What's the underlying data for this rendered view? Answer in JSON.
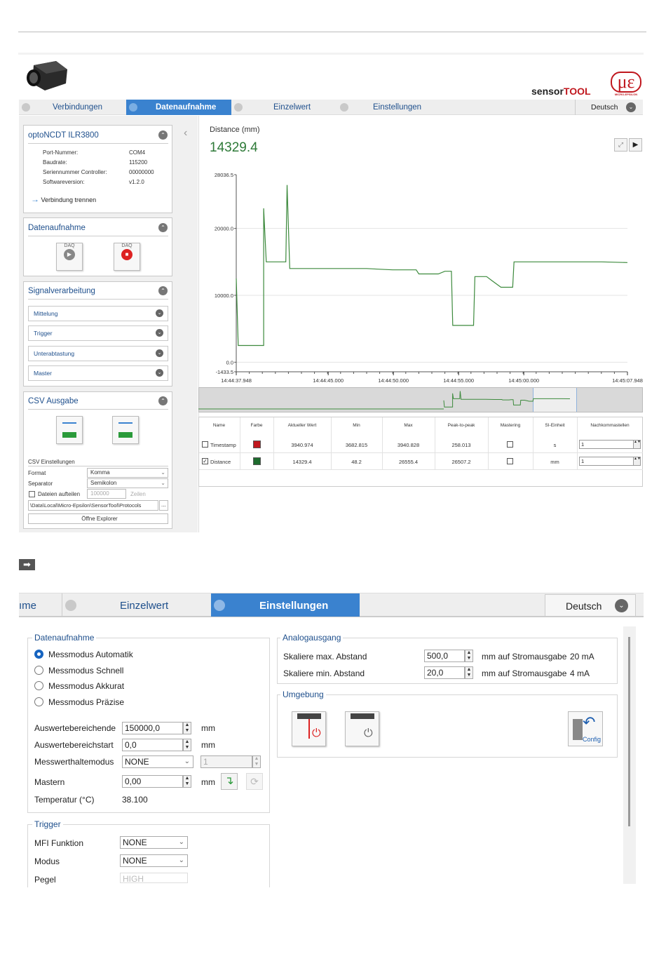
{
  "top": {
    "brand": "sensorTOOL",
    "brand_sensor": "sensor",
    "brand_tool": "TOOL",
    "logo_text": "με",
    "logo_sub": "MICRO-EPSILON",
    "language": "Deutsch"
  },
  "tabs": [
    "Verbindungen",
    "Datenaufnahme",
    "Einzelwert",
    "Einstellungen"
  ],
  "sensor_panel": {
    "title": "optoNCDT ILR3800",
    "rows": [
      {
        "k": "Port-Nummer:",
        "v": "COM4"
      },
      {
        "k": "Baudrate:",
        "v": "115200"
      },
      {
        "k": "Seriennummer Controller:",
        "v": "00000000"
      },
      {
        "k": "Softwareversion:",
        "v": "v1.2.0"
      }
    ],
    "disconnect": "Verbindung trennen"
  },
  "daq_panel": {
    "title": "Datenaufnahme",
    "btn_label": "DAQ"
  },
  "signal_panel": {
    "title": "Signalverarbeitung",
    "items": [
      "Mittelung",
      "Trigger",
      "Unterabtastung",
      "Master"
    ]
  },
  "csv_panel": {
    "title": "CSV Ausgabe",
    "settings_title": "CSV Einstellungen",
    "format_label": "Format",
    "format_value": "Komma",
    "separator_label": "Separator",
    "separator_value": "Semikolon",
    "split_label": "Dateien aufteilen",
    "split_value": "100000",
    "split_unit": "Zeilen",
    "path": "\\Data\\Local\\Micro-Epsilon\\SensorTool\\Protocols",
    "path_btn": "...",
    "explorer": "Öffne Explorer"
  },
  "chart_header": {
    "title": "Distance (mm)",
    "value": "14329.4"
  },
  "chart_data": {
    "type": "line",
    "ylim": [
      -1433.5,
      28036.5
    ],
    "y_ticks": [
      "28036.5",
      "20000.0",
      "10000.0",
      "0.0",
      "-1433.5"
    ],
    "x_ticks": [
      "14:44:37.948",
      "14:44:45.000",
      "14:44:50.000",
      "14:44:55.000",
      "14:45:00.000",
      "14:45:07.948"
    ],
    "x_tick_secs": [
      0,
      7.052,
      12.052,
      17.052,
      22.052,
      30
    ],
    "xlim_secs": [
      0,
      30
    ],
    "series": [
      {
        "color": "#3d8a3d",
        "points": [
          [
            0,
            12500
          ],
          [
            0.15,
            2500
          ],
          [
            2.1,
            2500
          ],
          [
            2.1,
            23000
          ],
          [
            2.3,
            15000
          ],
          [
            3.8,
            15000
          ],
          [
            3.9,
            26500
          ],
          [
            4.1,
            14000
          ],
          [
            10,
            14000
          ],
          [
            11,
            13900
          ],
          [
            12,
            13800
          ],
          [
            13.8,
            13800
          ],
          [
            14,
            13200
          ],
          [
            15.5,
            13200
          ],
          [
            16,
            13600
          ],
          [
            16.5,
            13600
          ],
          [
            16.6,
            5500
          ],
          [
            18.2,
            5500
          ],
          [
            18.3,
            12800
          ],
          [
            19.2,
            12800
          ],
          [
            19.6,
            12200
          ],
          [
            20.3,
            11200
          ],
          [
            21.2,
            11200
          ],
          [
            21.3,
            15000
          ],
          [
            28,
            15000
          ],
          [
            30,
            14900
          ]
        ]
      }
    ]
  },
  "overview_label": "",
  "table": {
    "headers": [
      "Name",
      "Farbe",
      "Aktueller Wert",
      "Min",
      "Max",
      "Peak-to-peak",
      "Mastering",
      "SI-Einheit",
      "Nachkommastellen"
    ],
    "rows": [
      {
        "name": "Timestamp",
        "color": "#c0171e",
        "value": "3940.974",
        "min": "3682.815",
        "max": "3940.828",
        "ptp": "258.013",
        "unit": "s",
        "dec": "1",
        "checked": false
      },
      {
        "name": "Distance",
        "color": "#1e6b2e",
        "value": "14329.4",
        "min": "48.2",
        "max": "26555.4",
        "ptp": "26507.2",
        "unit": "mm",
        "dec": "1",
        "checked": true
      }
    ]
  },
  "arrow": "➡",
  "settings": {
    "tab_left": "ıme",
    "tab_einzelwert": "Einzelwert",
    "tab_einstellungen": "Einstellungen",
    "language": "Deutsch",
    "daq_group": "Datenaufnahme",
    "modes": [
      "Messmodus Automatik",
      "Messmodus Schnell",
      "Messmodus Akkurat",
      "Messmodus Präzise"
    ],
    "fields": [
      {
        "label": "Auswertebereichende",
        "value": "150000,0",
        "unit": "mm"
      },
      {
        "label": "Auswertebereichstart",
        "value": "0,0",
        "unit": "mm"
      }
    ],
    "hold_label": "Messwerthaltemodus",
    "hold_value": "NONE",
    "hold_count": "1",
    "master_label": "Mastern",
    "master_value": "0,00",
    "master_unit": "mm",
    "temp_label": "Temperatur (°C)",
    "temp_value": "38.100",
    "trigger_group": "Trigger",
    "trigger_rows": [
      {
        "label": "MFI Funktion",
        "value": "NONE"
      },
      {
        "label": "Modus",
        "value": "NONE"
      },
      {
        "label": "Pegel",
        "value": "HIGH"
      }
    ],
    "analog_group": "Analogausgang",
    "analog_rows": [
      {
        "label": "Skaliere max. Abstand",
        "value": "500,0",
        "text": "mm auf Stromausgabe",
        "ma": "20 mA"
      },
      {
        "label": "Skaliere min. Abstand",
        "value": "20,0",
        "text": "mm auf Stromausgabe",
        "ma": "4 mA"
      }
    ],
    "env_group": "Umgebung",
    "config_label": "Config"
  }
}
